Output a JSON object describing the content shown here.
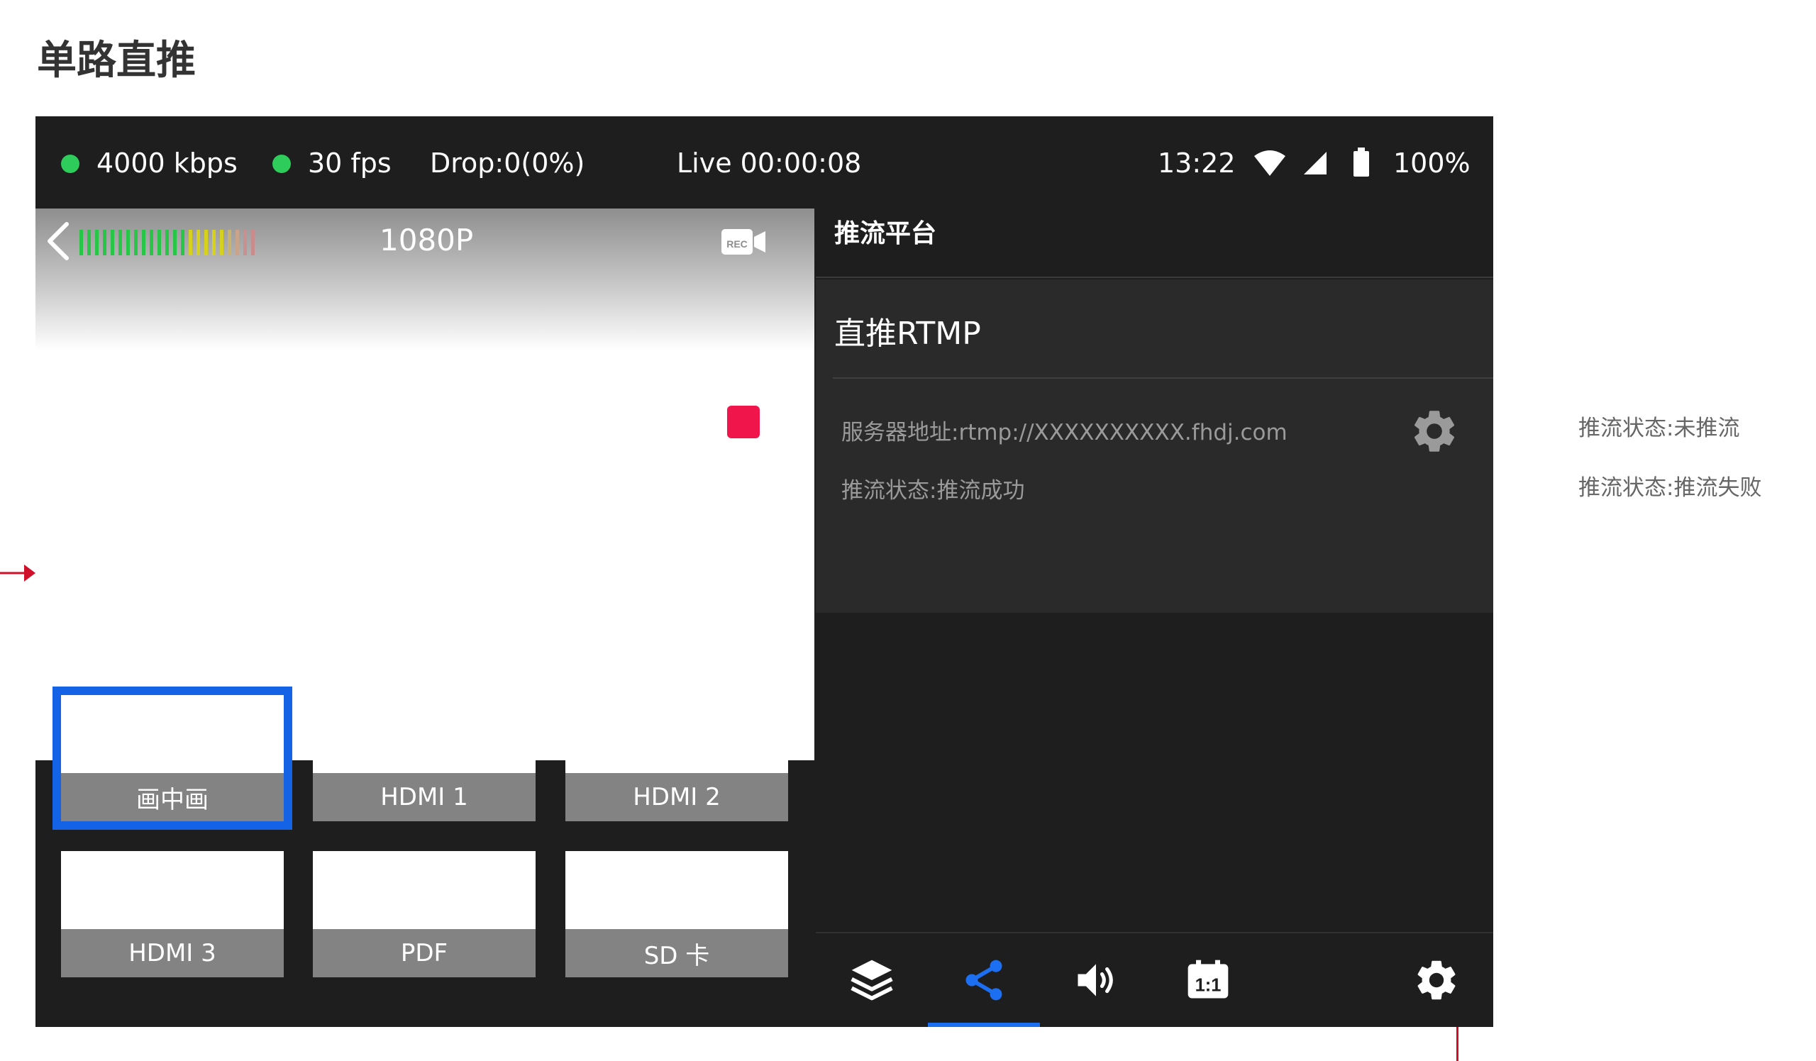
{
  "page": {
    "title": "单路直推"
  },
  "statusbar": {
    "bitrate": "4000 kbps",
    "fps": "30 fps",
    "drop": "Drop:0(0%)",
    "live": "Live 00:00:08",
    "time": "13:22",
    "battery": "100%",
    "indicator_color": "#2ecc5a",
    "icons": [
      "wifi-icon",
      "cellular-signal-icon",
      "battery-icon"
    ]
  },
  "preview": {
    "resolution": "1080P",
    "record_indicator_color": "#f0154a",
    "icons": [
      "back-chevron-icon",
      "audio-level-meter",
      "rec-camera-icon"
    ]
  },
  "sources": [
    {
      "label": "画中画",
      "selected": true
    },
    {
      "label": "HDMI 1",
      "selected": false
    },
    {
      "label": "HDMI 2",
      "selected": false
    },
    {
      "label": "HDMI 3",
      "selected": false
    },
    {
      "label": "PDF",
      "selected": false
    },
    {
      "label": "SD 卡",
      "selected": false
    }
  ],
  "panel": {
    "title": "推流平台",
    "platform": {
      "name": "直推RTMP",
      "server_label": "服务器地址:",
      "server_value": "rtmp://XXXXXXXXXX.fhdj.com",
      "status_label": "推流状态:",
      "status_value": "推流成功"
    }
  },
  "toolbar": {
    "items": [
      {
        "icon": "layers-icon",
        "active": false
      },
      {
        "icon": "share-icon",
        "active": true
      },
      {
        "icon": "volume-icon",
        "active": false
      },
      {
        "icon": "aspect-ratio-1-1-icon",
        "active": false
      },
      {
        "icon": "settings-gear-icon",
        "active": false
      }
    ],
    "accent_color": "#1c6ff0"
  },
  "notes": {
    "status_idle": "推流状态:未推流",
    "status_failed": "推流状态:推流失败"
  },
  "annotation_color": "#d0102a"
}
